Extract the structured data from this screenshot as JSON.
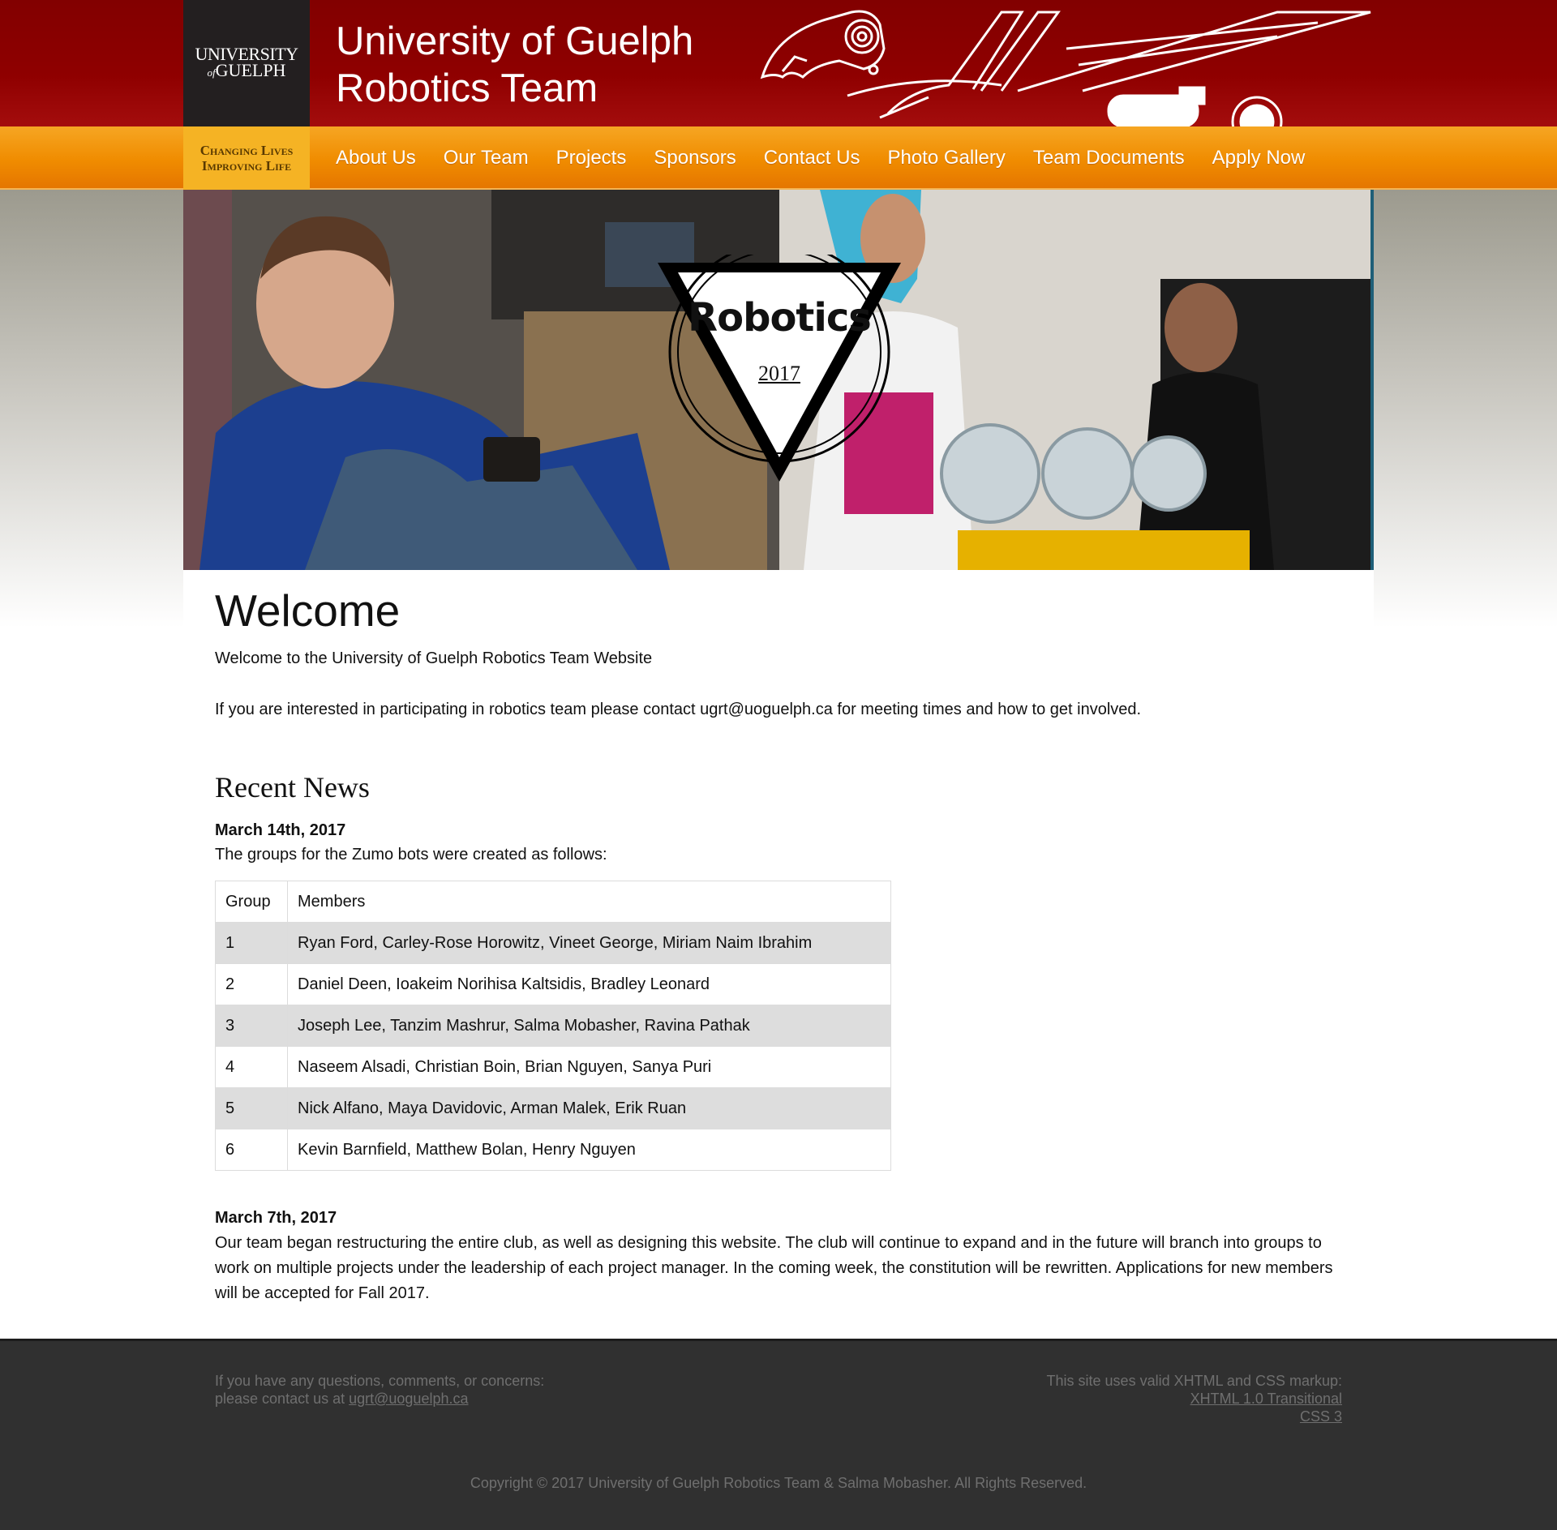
{
  "header": {
    "logo": {
      "line1": "UNIVERSITY",
      "of": "of",
      "line2": "GUELPH"
    },
    "tagline": {
      "line1": "Changing Lives",
      "line2": "Improving Life"
    },
    "title_line1": "University of Guelph",
    "title_line2": "Robotics Team"
  },
  "nav": {
    "items": [
      {
        "label": "About Us"
      },
      {
        "label": "Our Team"
      },
      {
        "label": "Projects"
      },
      {
        "label": "Sponsors"
      },
      {
        "label": "Contact Us"
      },
      {
        "label": "Photo Gallery"
      },
      {
        "label": "Team Documents"
      },
      {
        "label": "Apply Now"
      }
    ]
  },
  "hero": {
    "badge_title": "Robotics",
    "badge_year": "2017"
  },
  "main": {
    "heading": "Welcome",
    "intro": "Welcome to the University of Guelph Robotics Team Website",
    "contact_note": "If you are interested in participating in robotics team please contact ugrt@uoguelph.ca for meeting times and how to get involved.",
    "news_heading": "Recent News",
    "news": [
      {
        "date": "March 14th, 2017",
        "text": "The groups for the Zumo bots were created as follows:",
        "table": {
          "headers": [
            "Group",
            "Members"
          ],
          "rows": [
            [
              "1",
              "Ryan Ford, Carley-Rose Horowitz, Vineet George, Miriam Naim Ibrahim"
            ],
            [
              "2",
              "Daniel Deen, Ioakeim Norihisa Kaltsidis, Bradley Leonard"
            ],
            [
              "3",
              "Joseph Lee, Tanzim Mashrur, Salma Mobasher, Ravina Pathak"
            ],
            [
              "4",
              "Naseem Alsadi, Christian Boin, Brian Nguyen, Sanya Puri"
            ],
            [
              "5",
              "Nick Alfano, Maya Davidovic, Arman Malek, Erik Ruan"
            ],
            [
              "6",
              "Kevin Barnfield, Matthew Bolan, Henry Nguyen"
            ]
          ]
        }
      },
      {
        "date": "March 7th, 2017",
        "text": "Our team began restructuring the entire club, as well as designing this website. The club will continue to expand and in the future will branch into groups to work on multiple projects under the leadership of each project manager. In the coming week, the constitution will be rewritten. Applications for new members will be accepted for Fall 2017."
      }
    ]
  },
  "footer": {
    "left_line1": "If you have any questions, comments, or concerns:",
    "left_line2_prefix": "please contact us at ",
    "contact_email": "ugrt@uoguelph.ca",
    "right_line1": "This site uses valid XHTML and CSS markup:",
    "xhtml_link": "XHTML 1.0 Transitional",
    "css_link": "CSS 3",
    "copyright": "Copyright © 2017 University of Guelph Robotics Team & Salma Mobasher. All Rights Reserved."
  },
  "colors": {
    "header_red": "#8f0000",
    "nav_orange": "#f08c00",
    "tagline_gold": "#f5b324",
    "footer_bg": "#303030"
  }
}
